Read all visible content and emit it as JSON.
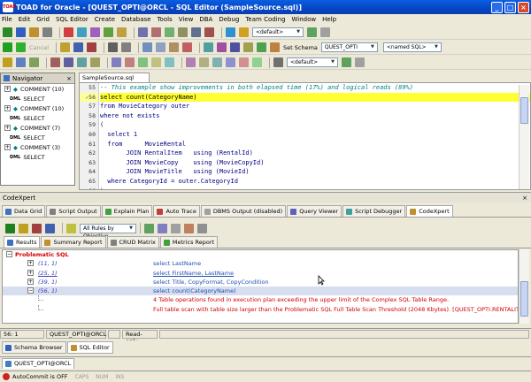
{
  "window": {
    "title": "TOAD for Oracle - [QUEST_OPTI@ORCL - SQL Editor (SampleSource.sql)]",
    "app_icon_text": "TOAD"
  },
  "menu": [
    "File",
    "Edit",
    "Grid",
    "SQL Editor",
    "Create",
    "Database",
    "Tools",
    "View",
    "DBA",
    "Debug",
    "Team Coding",
    "Window",
    "Help"
  ],
  "toolbar1": {
    "combo": "<default>"
  },
  "toolbar2": {
    "cancel_label": "Cancel",
    "set_schema_label": "Set Schema",
    "schema_value": "QUEST_OPTI",
    "named_sql_value": "<named SQL>"
  },
  "toolbar3": {
    "combo": "<default>"
  },
  "navigator": {
    "title": "Navigator",
    "items": [
      {
        "type": "comment",
        "label": "COMMENT  (10)"
      },
      {
        "type": "dml",
        "label": "SELECT"
      },
      {
        "type": "comment",
        "label": "COMMENT  (10)"
      },
      {
        "type": "dml",
        "label": "SELECT"
      },
      {
        "type": "comment",
        "label": "COMMENT  (7)"
      },
      {
        "type": "dml",
        "label": "SELECT"
      },
      {
        "type": "comment",
        "label": "COMMENT  (3)"
      },
      {
        "type": "dml",
        "label": "SELECT"
      }
    ],
    "dml_tag": "DML"
  },
  "editor": {
    "tab": "SampleSource.sql",
    "lines": [
      {
        "n": "55",
        "text": "-- This example show improvements in both elapsed time (17%) and logical reads (89%)",
        "style": "cmt"
      },
      {
        "n": "56",
        "text": "select count(CategoryName)",
        "style": "hl",
        "marker": "✓"
      },
      {
        "n": "57",
        "text": "from MovieCategory outer",
        "style": "kw"
      },
      {
        "n": "58",
        "text": "where not exists",
        "style": "kw"
      },
      {
        "n": "59",
        "text": "(",
        "style": "kw"
      },
      {
        "n": "60",
        "text": "  select 1",
        "style": "kw"
      },
      {
        "n": "61",
        "text": "  from      MovieRental",
        "style": "kw"
      },
      {
        "n": "62",
        "text": "       JOIN RentalItem   using (RentalId)",
        "style": "kw"
      },
      {
        "n": "63",
        "text": "       JOIN MovieCopy    using (MovieCopyId)",
        "style": "kw"
      },
      {
        "n": "64",
        "text": "       JOIN MovieTitle   using (MovieId)",
        "style": "kw"
      },
      {
        "n": "65",
        "text": "  where CategoryId = outer.CategoryId",
        "style": "kw"
      },
      {
        "n": "66",
        "text": ");",
        "style": "kw"
      }
    ]
  },
  "codexpert": {
    "title": "CodeXpert",
    "tabs": [
      "Data Grid",
      "Script Output",
      "Explain Plan",
      "Auto Trace",
      "DBMS Output (disabled)",
      "Query Viewer",
      "Script Debugger",
      "CodeXpert"
    ],
    "filter_value": "All Rules by Objective",
    "subtabs": [
      "Results",
      "Summary Report",
      "CRUD Matrix",
      "Metrics Report"
    ],
    "group_label": "Problematic SQL",
    "rows": [
      {
        "loc": "(11, 1)",
        "sql": "select LastName",
        "expand": "+"
      },
      {
        "loc": "(25, 1)",
        "sql": "select FirstName, LastName",
        "expand": "+"
      },
      {
        "loc": "(39, 1)",
        "sql": "select Title, CopyFormat, CopyCondition",
        "expand": "+"
      },
      {
        "loc": "(56, 1)",
        "sql": "select count(CategoryName)",
        "expand": "−",
        "selected": true
      }
    ],
    "messages": [
      "4 Table operations found in execution plan exceeding the upper limit of the Complex SQL Table Range.",
      "Full table scan with table size larger than the Problematic SQL Full Table Scan Threshold (2048 Kbytes). [QUEST_OPTI.RENTALITEM]"
    ]
  },
  "status": {
    "cursor": "56: 1",
    "connection": "QUEST_OPTI@ORCL",
    "mode": "Read-only"
  },
  "bottom_tabs": [
    "Schema Browser",
    "SQL Editor"
  ],
  "window_tab": "QUEST_OPTI@ORCL",
  "footer": {
    "autocommit": "AutoCommit is OFF",
    "caps": "CAPS",
    "num": "NUM",
    "ins": "INS"
  }
}
